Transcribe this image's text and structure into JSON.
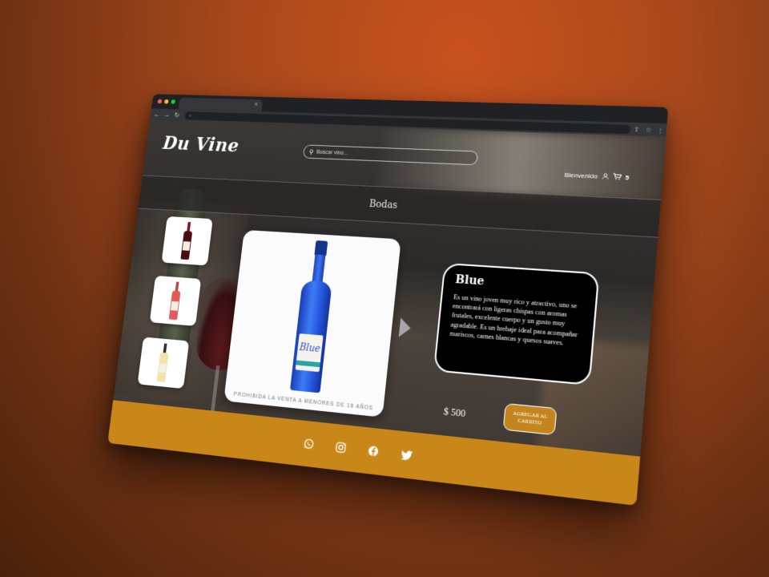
{
  "browser": {
    "omnibox_text": "⌕",
    "nav": {
      "back": "←",
      "forward": "→",
      "reload": "↻"
    },
    "tab_close": "×"
  },
  "header": {
    "logo": "Du Vine",
    "search_placeholder": "Buscar vino...",
    "welcome": "Bienvenido",
    "cart_count": "5"
  },
  "category": {
    "title": "Bodas"
  },
  "product": {
    "name": "Blue",
    "label_text": "Blue",
    "description": "Es un vino joven muy rico y atractivo, uno se encontrará con ligeras chispas con aromas frutales, excelente cuerpo y un gusto muy agradable. Es un brebaje ideal para acompañar mariscos, carnes blancas y quesos suaves.",
    "price": "$ 500",
    "add_to_cart": "AGREGAR AL CARRITO",
    "legal_notice": "PROHIBIDA LA VENTA A MENORES DE 18 AÑOS"
  },
  "thumbnails": [
    {
      "color": "#7a1420"
    },
    {
      "color": "#e35a5a"
    },
    {
      "color": "#f2e3a8"
    }
  ],
  "footer": {
    "icons": [
      "whatsapp-icon",
      "instagram-icon",
      "facebook-icon",
      "twitter-icon"
    ]
  },
  "colors": {
    "accent": "#c98719",
    "bottle_blue": "#2456dc"
  }
}
